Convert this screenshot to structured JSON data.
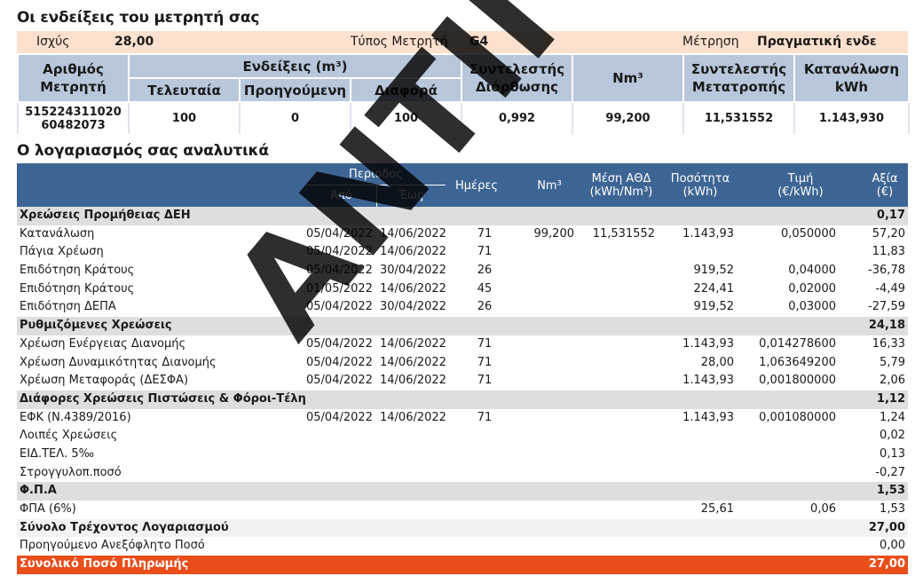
{
  "meter_section": {
    "title": "Οι ενδείξεις του μετρητή σας",
    "power_label": "Ισχύς",
    "power_value": "28,00",
    "meter_type_label": "Τύπος Μετρητή",
    "meter_type_value": "G4",
    "reading_label": "Μέτρηση",
    "reading_value": "Πραγματική ενδε",
    "headers": {
      "meter_number": "Αριθμός Μετρητή",
      "readings": "Ενδείξεις (m³)",
      "last": "Τελευταία",
      "previous": "Προηγούμενη",
      "difference": "Διαφορά",
      "correction_factor": "Συντελεστής Διόρθωσης",
      "nm3": "Nm³",
      "conversion_factor": "Συντελεστής Μετατροπής",
      "consumption_kwh": "Κατανάλωση kWh"
    },
    "row": {
      "meter_number_1": "515224311020",
      "meter_number_2": "60482073",
      "last": "100",
      "previous": "0",
      "difference": "100",
      "correction_factor": "0,992",
      "nm3": "99,200",
      "conversion_factor": "11,531552",
      "consumption_kwh": "1.143,930"
    }
  },
  "bill_section": {
    "title": "Ο λογαριασμός σας αναλυτικά",
    "headers": {
      "period": "Περίοδος",
      "from": "Από",
      "to": "Έως",
      "days": "Ημέρες",
      "nm3": "Nm³",
      "avg_gcv": "Μέση ΑΘΔ (kWh/Nm³)",
      "quantity": "Ποσότητα (kWh)",
      "price": "Τιμή (€/kWh)",
      "value": "Αξία (€)"
    },
    "rows": [
      {
        "type": "group",
        "label": "Χρεώσεις Προμήθειας ΔΕΗ",
        "from": "",
        "to": "",
        "days": "",
        "nm3": "",
        "avg": "",
        "qty": "",
        "price": "",
        "value": "0,17"
      },
      {
        "type": "item",
        "label": "Κατανάλωση",
        "from": "05/04/2022",
        "to": "14/06/2022",
        "days": "71",
        "nm3": "99,200",
        "avg": "11,531552",
        "qty": "1.143,93",
        "price": "0,050000",
        "value": "57,20"
      },
      {
        "type": "item",
        "label": "Πάγια Χρέωση",
        "from": "05/04/2022",
        "to": "14/06/2022",
        "days": "71",
        "nm3": "",
        "avg": "",
        "qty": "",
        "price": "",
        "value": "11,83"
      },
      {
        "type": "item",
        "label": "Επιδότηση Κράτους",
        "from": "05/04/2022",
        "to": "30/04/2022",
        "days": "26",
        "nm3": "",
        "avg": "",
        "qty": "919,52",
        "price": "0,04000",
        "value": "-36,78"
      },
      {
        "type": "item",
        "label": "Επιδότηση Κράτους",
        "from": "01/05/2022",
        "to": "14/06/2022",
        "days": "45",
        "nm3": "",
        "avg": "",
        "qty": "224,41",
        "price": "0,02000",
        "value": "-4,49"
      },
      {
        "type": "item",
        "label": "Επιδότηση ΔΕΠΑ",
        "from": "05/04/2022",
        "to": "30/04/2022",
        "days": "26",
        "nm3": "",
        "avg": "",
        "qty": "919,52",
        "price": "0,03000",
        "value": "-27,59"
      },
      {
        "type": "group",
        "label": "Ρυθμιζόμενες Χρεώσεις",
        "from": "",
        "to": "",
        "days": "",
        "nm3": "",
        "avg": "",
        "qty": "",
        "price": "",
        "value": "24,18"
      },
      {
        "type": "item",
        "label": "Χρέωση Ενέργειας Διανομής",
        "from": "05/04/2022",
        "to": "14/06/2022",
        "days": "71",
        "nm3": "",
        "avg": "",
        "qty": "1.143,93",
        "price": "0,014278600",
        "value": "16,33"
      },
      {
        "type": "item",
        "label": "Χρέωση Δυναμικότητας Διανομής",
        "from": "05/04/2022",
        "to": "14/06/2022",
        "days": "71",
        "nm3": "",
        "avg": "",
        "qty": "28,00",
        "price": "1,063649200",
        "value": "5,79"
      },
      {
        "type": "item",
        "label": "Χρέωση Μεταφοράς (ΔΕΣΦΑ)",
        "from": "05/04/2022",
        "to": "14/06/2022",
        "days": "71",
        "nm3": "",
        "avg": "",
        "qty": "1.143,93",
        "price": "0,001800000",
        "value": "2,06"
      },
      {
        "type": "group",
        "label": "Διάφορες Χρεώσεις Πιστώσεις & Φόροι-Τέλη",
        "from": "",
        "to": "",
        "days": "",
        "nm3": "",
        "avg": "",
        "qty": "",
        "price": "",
        "value": "1,12"
      },
      {
        "type": "item",
        "label": "ΕΦΚ (Ν.4389/2016)",
        "from": "05/04/2022",
        "to": "14/06/2022",
        "days": "71",
        "nm3": "",
        "avg": "",
        "qty": "1.143,93",
        "price": "0,001080000",
        "value": "1,24"
      },
      {
        "type": "item",
        "label": "Λοιπές Χρεώσεις",
        "from": "",
        "to": "",
        "days": "",
        "nm3": "",
        "avg": "",
        "qty": "",
        "price": "",
        "value": "0,02"
      },
      {
        "type": "item",
        "label": "ΕΙΔ.ΤΕΛ. 5‰",
        "from": "",
        "to": "",
        "days": "",
        "nm3": "",
        "avg": "",
        "qty": "",
        "price": "",
        "value": "0,13"
      },
      {
        "type": "item",
        "label": "Στρογγυλοπ.ποσό",
        "from": "",
        "to": "",
        "days": "",
        "nm3": "",
        "avg": "",
        "qty": "",
        "price": "",
        "value": "-0,27"
      },
      {
        "type": "group",
        "label": "Φ.Π.Α",
        "from": "",
        "to": "",
        "days": "",
        "nm3": "",
        "avg": "",
        "qty": "",
        "price": "",
        "value": "1,53"
      },
      {
        "type": "item",
        "label": "ΦΠΑ (6%)",
        "from": "",
        "to": "",
        "days": "",
        "nm3": "",
        "avg": "",
        "qty": "25,61",
        "price": "0,06",
        "value": "1,53"
      },
      {
        "type": "total",
        "label": "Σύνολο Τρέχοντος Λογαριασμού",
        "from": "",
        "to": "",
        "days": "",
        "nm3": "",
        "avg": "",
        "qty": "",
        "price": "",
        "value": "27,00"
      },
      {
        "type": "item",
        "label": "Προηγούμενο Ανεξόφλητο Ποσό",
        "from": "",
        "to": "",
        "days": "",
        "nm3": "",
        "avg": "",
        "qty": "",
        "price": "",
        "value": "0,00"
      },
      {
        "type": "final",
        "label": "Συνολικό Ποσό Πληρωμής",
        "from": "",
        "to": "",
        "days": "",
        "nm3": "",
        "avg": "",
        "qty": "",
        "price": "",
        "value": "27,00"
      }
    ]
  },
  "watermark": "ΑΝΤΙΓΡΑΦΟ"
}
